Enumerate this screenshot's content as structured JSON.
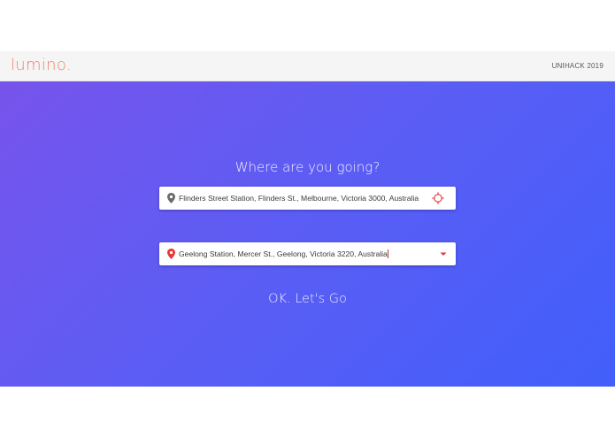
{
  "navbar": {
    "brand": "lumino.",
    "right_text": "UNIHACK 2019"
  },
  "hero": {
    "question": "Where are you going?",
    "origin": {
      "value": "Flinders Street Station, Flinders St., Melbourne, Victoria 3000, Australia",
      "pin_icon": "location-pin-icon",
      "action_icon": "crosshair-locate-icon",
      "pin_color": "#6b6b6b"
    },
    "destination": {
      "value": "Geelong Station, Mercer St., Geelong, Victoria 3220, Australia",
      "pin_icon": "location-pin-icon",
      "action_icon": "dropdown-arrow-icon",
      "pin_color": "#e53935"
    },
    "submit_label": "OK. Let's Go"
  },
  "colors": {
    "brand": "#f2826a",
    "gradient_start": "#7754ec",
    "gradient_end": "#415ffb",
    "accent_red": "#e53935"
  }
}
